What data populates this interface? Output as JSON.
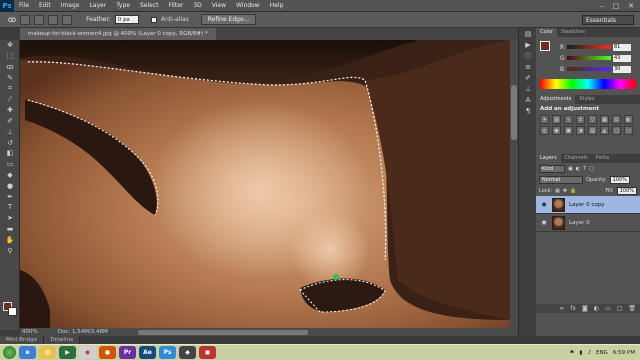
{
  "app": {
    "logo": "Ps"
  },
  "menu": [
    "File",
    "Edit",
    "Image",
    "Layer",
    "Type",
    "Select",
    "Filter",
    "3D",
    "View",
    "Window",
    "Help"
  ],
  "window_controls": [
    "–",
    "□",
    "✕"
  ],
  "options_bar": {
    "feather_label": "Feather:",
    "feather_value": "0 px",
    "antialias_label": "Anti-alias",
    "refine_edge_label": "Refine Edge...",
    "workspace": "Essentials"
  },
  "document": {
    "tab_title": "makeup-for-black-women4.jpg @ 400% (Layer 0 copy, RGB/8#) *",
    "zoom": "400%",
    "doc_size": "Doc: 1.54M/3.48M"
  },
  "bottom_tabs": [
    "Mini Bridge",
    "Timeline"
  ],
  "color_panel": {
    "tabs": [
      "Color",
      "Swatches"
    ],
    "sliders": [
      {
        "label": "R",
        "value": "81"
      },
      {
        "label": "G",
        "value": "43"
      },
      {
        "label": "B",
        "value": "30"
      }
    ],
    "foreground": "#6b3015",
    "background": "#ffffff"
  },
  "adjustments_panel": {
    "tabs": [
      "Adjustments",
      "Styles"
    ],
    "title": "Add an adjustment"
  },
  "layers_panel": {
    "tabs": [
      "Layers",
      "Channels",
      "Paths"
    ],
    "filter_kind": "Kind",
    "blend_mode": "Normal",
    "opacity_label": "Opacity:",
    "opacity_value": "100%",
    "lock_label": "Lock:",
    "fill_label": "Fill:",
    "fill_value": "100%",
    "layers": [
      {
        "name": "Layer 0 copy",
        "selected": true
      },
      {
        "name": "Layer 0",
        "selected": false
      }
    ]
  },
  "taskbar": {
    "language": "ENG",
    "time": "6:59 PM"
  },
  "colors": {
    "accent_selection": "#9db7e2",
    "taskbar": "#c9d1a2"
  }
}
